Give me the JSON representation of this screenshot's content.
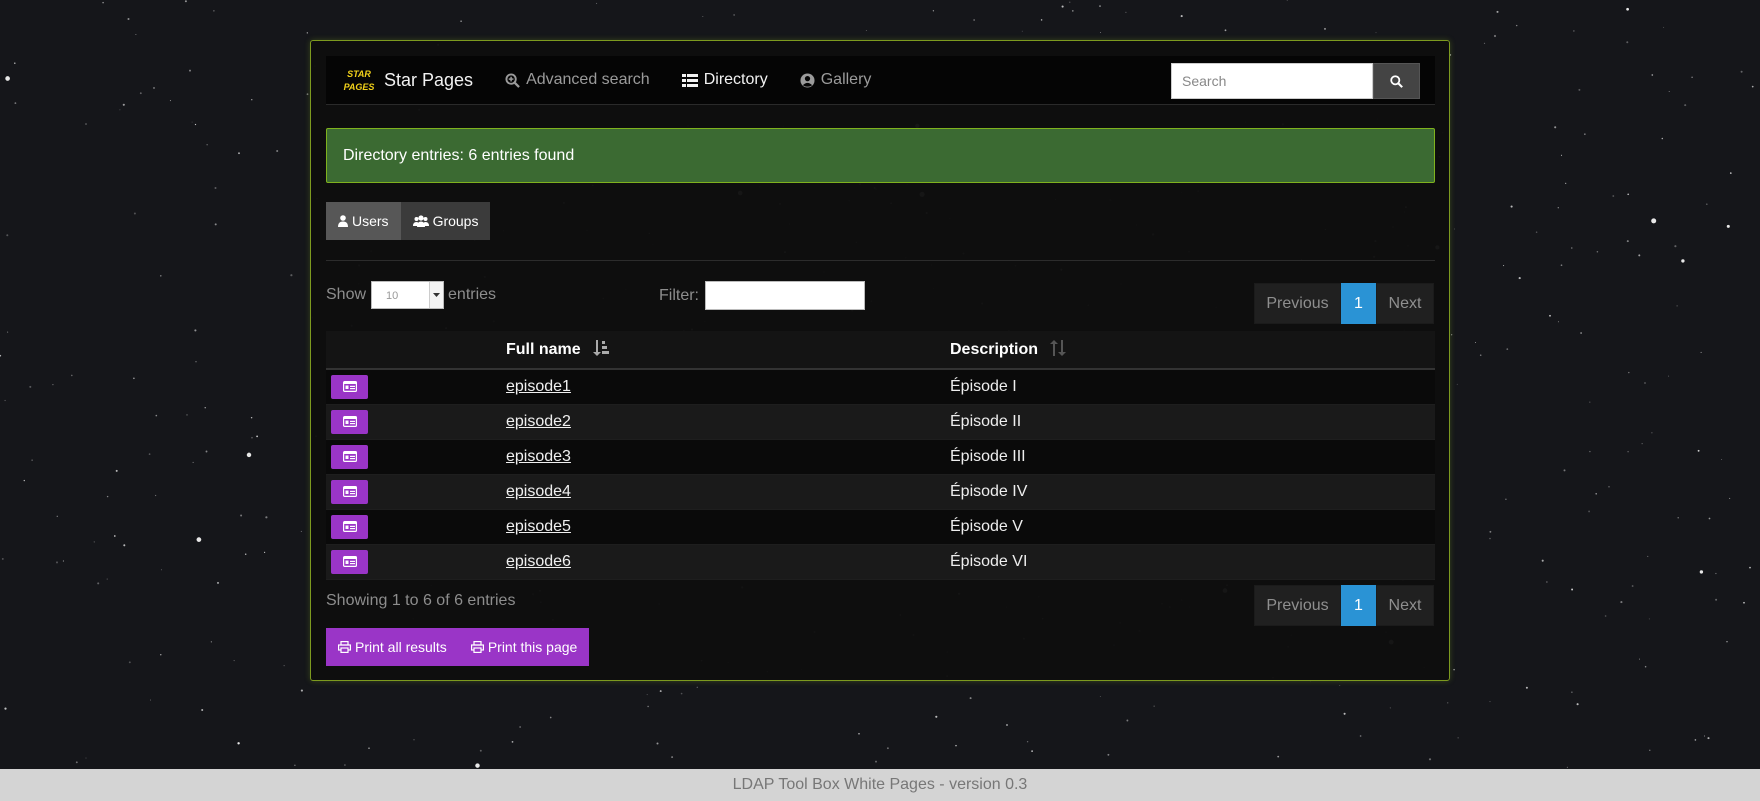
{
  "navbar": {
    "logo_text": "STAR PAGES",
    "brand": "Star Pages",
    "links": [
      {
        "label": "Advanced search",
        "icon": "search-plus-icon"
      },
      {
        "label": "Directory",
        "icon": "list-icon",
        "active": true
      },
      {
        "label": "Gallery",
        "icon": "user-circle-icon"
      }
    ],
    "search_placeholder": "Search",
    "search_value": ""
  },
  "alert": {
    "text": "Directory entries: 6 entries found"
  },
  "tabs": [
    {
      "label": "Users",
      "icon": "user-icon",
      "active": true
    },
    {
      "label": "Groups",
      "icon": "users-icon"
    }
  ],
  "table_controls": {
    "show_label": "Show",
    "length_value": "10",
    "entries_label": "entries",
    "filter_label": "Filter:",
    "filter_value": ""
  },
  "pagination": {
    "previous": "Previous",
    "page": "1",
    "next": "Next"
  },
  "table": {
    "columns": [
      "Full name",
      "Description"
    ],
    "rows": [
      {
        "name": "episode1",
        "description": "Épisode I"
      },
      {
        "name": "episode2",
        "description": "Épisode II"
      },
      {
        "name": "episode3",
        "description": "Épisode III"
      },
      {
        "name": "episode4",
        "description": "Épisode IV"
      },
      {
        "name": "episode5",
        "description": "Épisode V"
      },
      {
        "name": "episode6",
        "description": "Épisode VI"
      }
    ]
  },
  "info": "Showing 1 to 6 of 6 entries",
  "print": {
    "all_label": "Print all results",
    "page_label": "Print this page"
  },
  "footer": "LDAP Tool Box White Pages - version 0.3",
  "colors": {
    "accent_purple": "#9a35c7",
    "alert_green": "#3b6a32",
    "page_blue": "#2a93d5",
    "border_olive": "#7d9a1f"
  }
}
